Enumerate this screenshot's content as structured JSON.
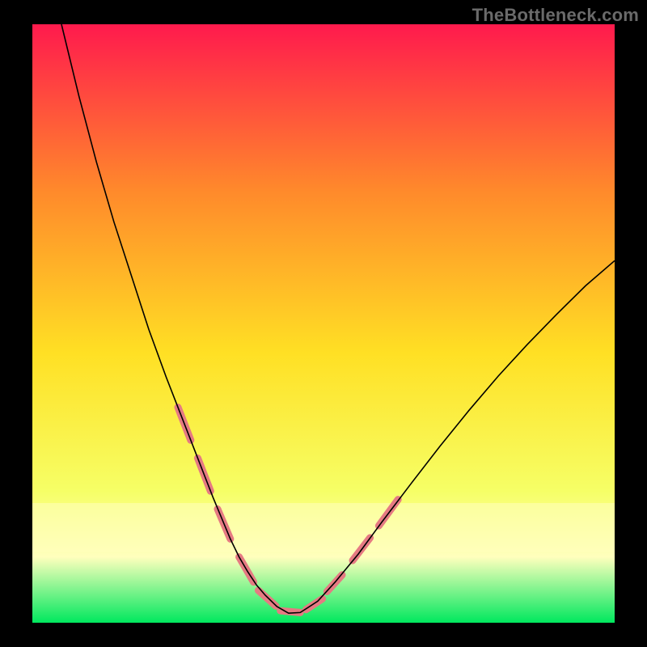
{
  "watermark": "TheBottleneck.com",
  "chart_data": {
    "type": "line",
    "title": "",
    "xlabel": "",
    "ylabel": "",
    "xlim": [
      0,
      100
    ],
    "ylim": [
      0,
      100
    ],
    "background_gradient": {
      "top": "#ff1a4d",
      "upper_mid": "#ff8a2b",
      "mid": "#ffe024",
      "lower_mid": "#f6ff66",
      "band": "#ffffbd",
      "bottom": "#00e85e"
    },
    "series": [
      {
        "name": "curve",
        "stroke": "#000000",
        "stroke_width": 1.6,
        "x": [
          5,
          8,
          11,
          14,
          17,
          20,
          23,
          25,
          27,
          29,
          31,
          32.5,
          34,
          35.5,
          37,
          38.5,
          40,
          42,
          44,
          46,
          49,
          52,
          56,
          60,
          65,
          70,
          75,
          80,
          85,
          90,
          95,
          100
        ],
        "y": [
          100,
          88,
          77,
          67,
          58,
          49,
          41,
          36,
          31,
          26,
          21,
          17.5,
          14,
          11,
          8.5,
          6.3,
          4.6,
          2.7,
          1.6,
          1.7,
          3.6,
          6.8,
          11.5,
          16.8,
          23.2,
          29.5,
          35.5,
          41.2,
          46.5,
          51.5,
          56.3,
          60.5
        ]
      }
    ],
    "highlight_segments": {
      "stroke": "#e57a82",
      "stroke_width": 9,
      "segments": [
        {
          "x": [
            25.0,
            27.2
          ],
          "y": [
            36.0,
            30.5
          ]
        },
        {
          "x": [
            28.4,
            30.6
          ],
          "y": [
            27.5,
            22.0
          ]
        },
        {
          "x": [
            31.8,
            34.0
          ],
          "y": [
            19.0,
            14.0
          ]
        },
        {
          "x": [
            35.5,
            38.0
          ],
          "y": [
            11.0,
            6.8
          ]
        },
        {
          "x": [
            38.8,
            41.8
          ],
          "y": [
            5.4,
            2.8
          ]
        },
        {
          "x": [
            42.6,
            46.0
          ],
          "y": [
            2.0,
            1.7
          ]
        },
        {
          "x": [
            47.0,
            49.8
          ],
          "y": [
            2.2,
            4.0
          ]
        },
        {
          "x": [
            50.6,
            53.2
          ],
          "y": [
            5.2,
            8.0
          ]
        },
        {
          "x": [
            55.0,
            58.0
          ],
          "y": [
            10.4,
            14.2
          ]
        },
        {
          "x": [
            59.5,
            62.8
          ],
          "y": [
            16.2,
            20.6
          ]
        }
      ]
    }
  }
}
